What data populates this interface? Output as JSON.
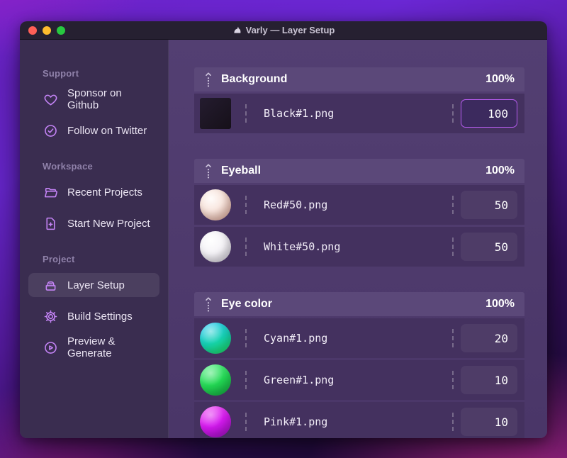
{
  "window": {
    "title": "Varly — Layer Setup",
    "title_icon": "unicorn-icon",
    "traffic_lights": [
      "close",
      "minimize",
      "zoom"
    ]
  },
  "sidebar": {
    "sections": [
      {
        "label": "Support",
        "items": [
          {
            "label": "Sponsor on Github",
            "icon": "heart-icon",
            "selected": false
          },
          {
            "label": "Follow on Twitter",
            "icon": "check-badge-icon",
            "selected": false
          }
        ]
      },
      {
        "label": "Workspace",
        "items": [
          {
            "label": "Recent Projects",
            "icon": "folder-icon",
            "selected": false
          },
          {
            "label": "Start New Project",
            "icon": "file-plus-icon",
            "selected": false
          }
        ]
      },
      {
        "label": "Project",
        "items": [
          {
            "label": "Layer Setup",
            "icon": "layer-box-icon",
            "selected": true
          },
          {
            "label": "Build Settings",
            "icon": "gear-icon",
            "selected": false
          },
          {
            "label": "Preview & Generate",
            "icon": "play-circle-icon",
            "selected": false
          }
        ]
      }
    ]
  },
  "main": {
    "groups": [
      {
        "name": "Background",
        "weight": "100%",
        "layers": [
          {
            "file": "Black#1.png",
            "value": "100",
            "thumb": "black",
            "focused": true
          }
        ]
      },
      {
        "name": "Eyeball",
        "weight": "100%",
        "layers": [
          {
            "file": "Red#50.png",
            "value": "50",
            "thumb": "red",
            "focused": false
          },
          {
            "file": "White#50.png",
            "value": "50",
            "thumb": "white",
            "focused": false
          }
        ]
      },
      {
        "name": "Eye color",
        "weight": "100%",
        "layers": [
          {
            "file": "Cyan#1.png",
            "value": "20",
            "thumb": "cyan",
            "focused": false
          },
          {
            "file": "Green#1.png",
            "value": "10",
            "thumb": "green",
            "focused": false
          },
          {
            "file": "Pink#1.png",
            "value": "10",
            "thumb": "pink",
            "focused": false
          }
        ]
      }
    ]
  },
  "colors": {
    "accent_purple": "#b75cf0",
    "icon_purple": "#c584f7",
    "titlebar_bg": "#262031",
    "sidebar_bg": "#3a2d50",
    "main_bg": "#503c6e",
    "group_header_bg": "#5b4879",
    "row_bg": "#44315f",
    "traffic_red": "#ff5f57",
    "traffic_yellow": "#febc2e",
    "traffic_green": "#28c840"
  }
}
